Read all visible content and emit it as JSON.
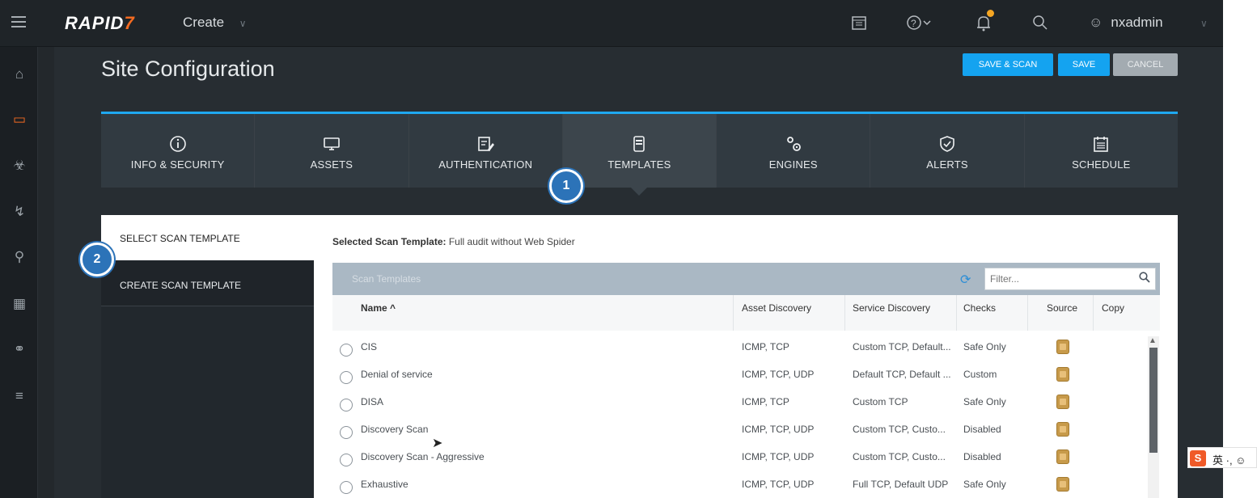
{
  "topbar": {
    "logo_main": "RAPID",
    "logo_accent": "7",
    "create_label": "Create",
    "username": "nxadmin"
  },
  "page": {
    "title": "Site Configuration"
  },
  "actions": {
    "save_scan": "SAVE & SCAN",
    "save": "SAVE",
    "cancel": "CANCEL"
  },
  "tabs": [
    {
      "label": "INFO & SECURITY",
      "icon": "info-icon"
    },
    {
      "label": "ASSETS",
      "icon": "monitor-icon"
    },
    {
      "label": "AUTHENTICATION",
      "icon": "credential-icon"
    },
    {
      "label": "TEMPLATES",
      "icon": "template-icon",
      "active": true
    },
    {
      "label": "ENGINES",
      "icon": "gears-icon"
    },
    {
      "label": "ALERTS",
      "icon": "shield-check-icon"
    },
    {
      "label": "SCHEDULE",
      "icon": "calendar-icon"
    }
  ],
  "steps": {
    "one": "1",
    "two": "2"
  },
  "subnav": {
    "select": "SELECT SCAN TEMPLATE",
    "create": "CREATE SCAN TEMPLATE"
  },
  "selected": {
    "label": "Selected Scan Template:",
    "value": "Full audit without Web Spider"
  },
  "table": {
    "title": "Scan Templates",
    "filter_placeholder": "Filter...",
    "columns": {
      "name": "Name ^",
      "asset_discovery": "Asset Discovery",
      "service_discovery": "Service Discovery",
      "checks": "Checks",
      "source": "Source",
      "copy": "Copy"
    },
    "rows": [
      {
        "name": "CIS",
        "asset": "ICMP, TCP",
        "service": "Custom TCP, Default...",
        "checks": "Safe Only"
      },
      {
        "name": "Denial of service",
        "asset": "ICMP, TCP, UDP",
        "service": "Default TCP, Default ...",
        "checks": "Custom"
      },
      {
        "name": "DISA",
        "asset": "ICMP, TCP",
        "service": "Custom TCP",
        "checks": "Safe Only"
      },
      {
        "name": "Discovery Scan",
        "asset": "ICMP, TCP, UDP",
        "service": "Custom TCP, Custo...",
        "checks": "Disabled"
      },
      {
        "name": "Discovery Scan - Aggressive",
        "asset": "ICMP, TCP, UDP",
        "service": "Custom TCP, Custo...",
        "checks": "Disabled"
      },
      {
        "name": "Exhaustive",
        "asset": "ICMP, TCP, UDP",
        "service": "Full TCP, Default UDP",
        "checks": "Safe Only"
      }
    ]
  },
  "ime": {
    "logo": "S",
    "text": "英 ·, ☺"
  },
  "colors": {
    "accent_blue": "#14a3f0",
    "brand_orange": "#f26a21",
    "step_badge": "#2c73b8"
  }
}
